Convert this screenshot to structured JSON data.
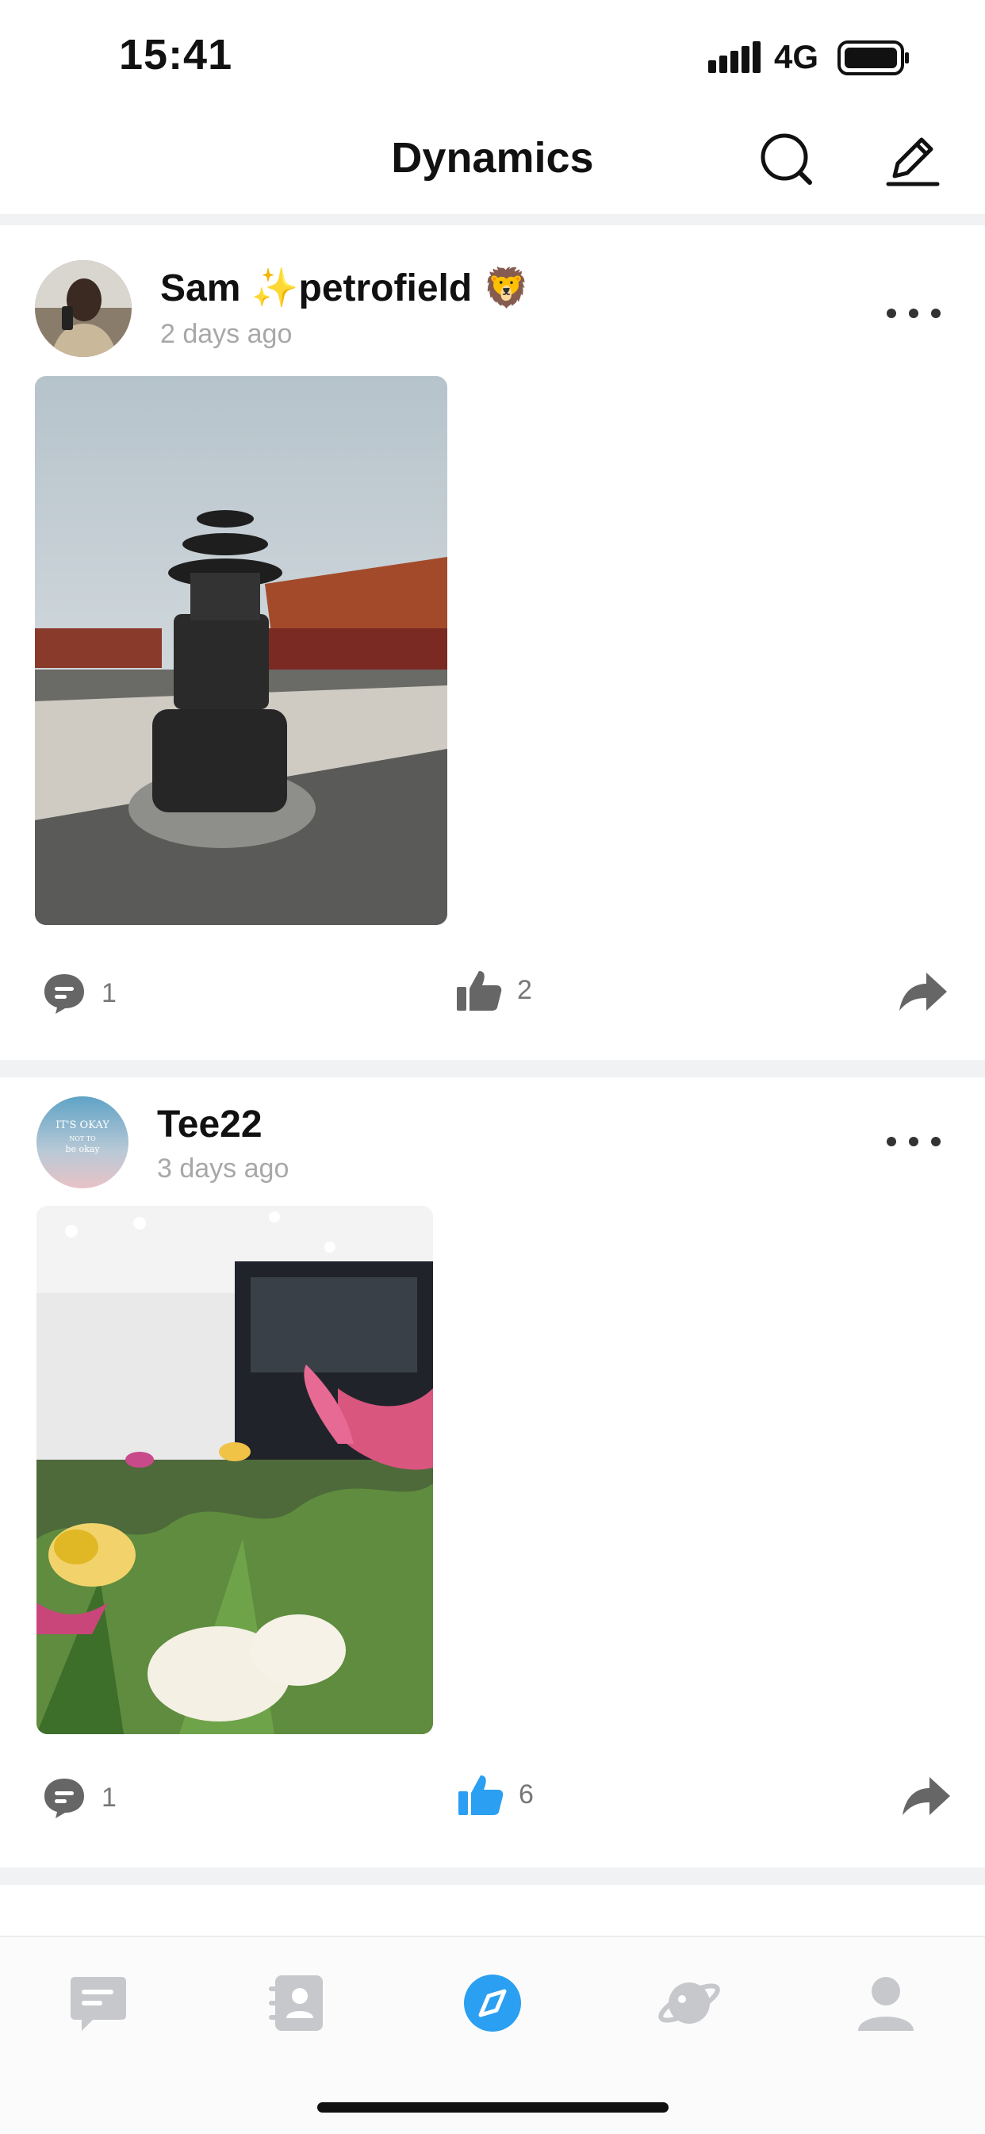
{
  "status_bar": {
    "time": "15:41",
    "network": "4G"
  },
  "header": {
    "title": "Dynamics",
    "search_icon": "search-icon",
    "edit_icon": "edit-icon"
  },
  "posts": [
    {
      "author": "Sam ✨petrofield 🦁",
      "time": "2 days ago",
      "comments": "1",
      "likes": "2",
      "liked": false
    },
    {
      "author": "Tee22",
      "time": "3 days ago",
      "avatar_text": [
        "IT'S OKAY",
        "NOT TO",
        "be okay"
      ],
      "comments": "1",
      "likes": "6",
      "liked": true
    }
  ],
  "tabbar": {
    "items": [
      {
        "icon": "chat-icon",
        "active": false
      },
      {
        "icon": "contacts-icon",
        "active": false
      },
      {
        "icon": "compass-icon",
        "active": true
      },
      {
        "icon": "planet-icon",
        "active": false
      },
      {
        "icon": "profile-icon",
        "active": false
      }
    ]
  },
  "colors": {
    "accent": "#2b9ff1",
    "inactive_icon": "#c7c8cc",
    "action_icon": "#666666",
    "muted_text": "#a8a8a8"
  }
}
